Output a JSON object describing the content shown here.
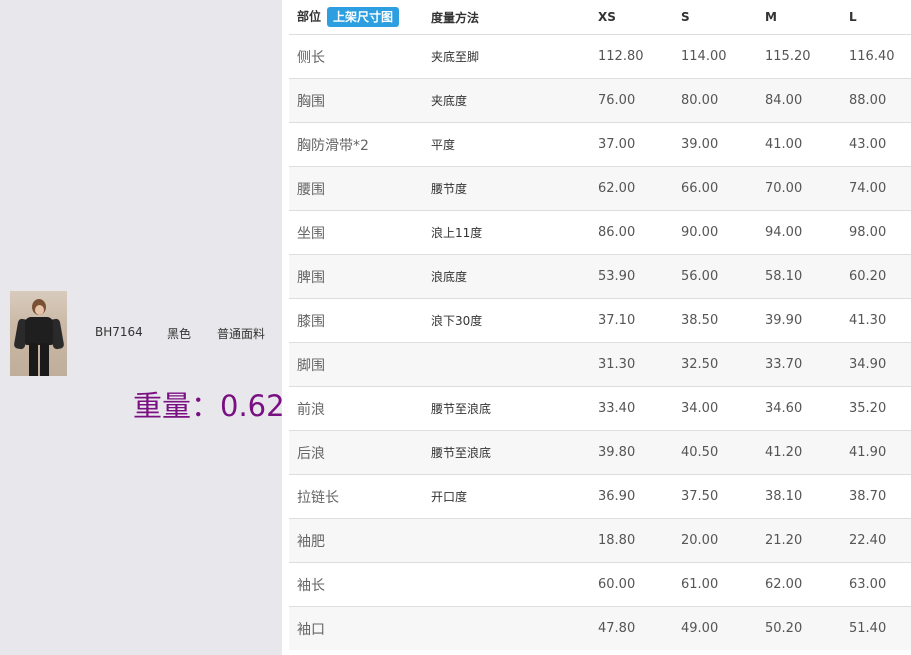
{
  "product": {
    "sku": "BH7164",
    "color": "黑色",
    "fabric": "普通面料",
    "weight_label": "重量：0.62"
  },
  "table": {
    "headers": {
      "part": "部位",
      "upload_button": "上架尺寸图",
      "method": "度量方法",
      "sizes": [
        "XS",
        "S",
        "M",
        "L"
      ]
    },
    "rows": [
      {
        "part": "侧长",
        "method": "夹底至脚",
        "values": [
          "112.80",
          "114.00",
          "115.20",
          "116.40"
        ]
      },
      {
        "part": "胸围",
        "method": "夹底度",
        "values": [
          "76.00",
          "80.00",
          "84.00",
          "88.00"
        ]
      },
      {
        "part": "胸防滑带*2",
        "method": "平度",
        "values": [
          "37.00",
          "39.00",
          "41.00",
          "43.00"
        ]
      },
      {
        "part": "腰围",
        "method": "腰节度",
        "values": [
          "62.00",
          "66.00",
          "70.00",
          "74.00"
        ]
      },
      {
        "part": "坐围",
        "method": "浪上11度",
        "values": [
          "86.00",
          "90.00",
          "94.00",
          "98.00"
        ]
      },
      {
        "part": "脾围",
        "method": "浪底度",
        "values": [
          "53.90",
          "56.00",
          "58.10",
          "60.20"
        ]
      },
      {
        "part": "膝围",
        "method": "浪下30度",
        "values": [
          "37.10",
          "38.50",
          "39.90",
          "41.30"
        ]
      },
      {
        "part": "脚围",
        "method": "",
        "values": [
          "31.30",
          "32.50",
          "33.70",
          "34.90"
        ]
      },
      {
        "part": "前浪",
        "method": "腰节至浪底",
        "values": [
          "33.40",
          "34.00",
          "34.60",
          "35.20"
        ]
      },
      {
        "part": "后浪",
        "method": "腰节至浪底",
        "values": [
          "39.80",
          "40.50",
          "41.20",
          "41.90"
        ]
      },
      {
        "part": "拉链长",
        "method": "开口度",
        "values": [
          "36.90",
          "37.50",
          "38.10",
          "38.70"
        ]
      },
      {
        "part": "袖肥",
        "method": "",
        "values": [
          "18.80",
          "20.00",
          "21.20",
          "22.40"
        ]
      },
      {
        "part": "袖长",
        "method": "",
        "values": [
          "60.00",
          "61.00",
          "62.00",
          "63.00"
        ]
      },
      {
        "part": "袖口",
        "method": "",
        "values": [
          "47.80",
          "49.00",
          "50.20",
          "51.40"
        ]
      }
    ]
  }
}
